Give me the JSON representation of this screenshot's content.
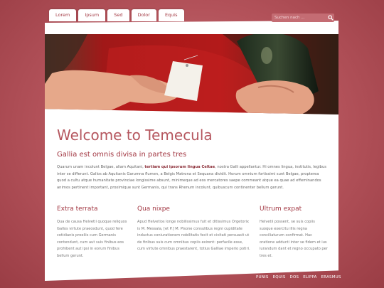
{
  "tabs": [
    "Lorem",
    "Ipsum",
    "Sed",
    "Dolor",
    "Equis"
  ],
  "search": {
    "placeholder": "Suchen nach ..."
  },
  "page": {
    "title": "Welcome to Temecula",
    "subtitle": "Gallia est omnis divisa in partes tres",
    "intro_before": "Quarum unam incolunt Belgae, aliam Aquitani, ",
    "intro_bold": "tertiam qui ipsorum lingua Celtae",
    "intro_after": ", nostra Galli appellantur. Hi omnes lingua, institutis, legibus inter se differunt. Gallos ab Aquitanis Garumna flumen, a Belgis Matrona et Sequana dividit. Horum omnium fortissimi sunt Belgae, propterea quod a cultu atque humanitate provinciae longissime absunt, minimeque ad eos mercatores saepe commeant atque ea quae ad effeminandos animos pertinent important, proximique sunt Germanis, qui trans Rhenum incolunt, quibuscum continenter bellum gerunt."
  },
  "columns": [
    {
      "heading": "Extra terrata",
      "text": "Qua de causa Helvetii quoque reliquos Gallos virtute praecedunt, quod fere cotidianis proeliis cum Germanis contendunt, cum aut suis finibus eos prohibent aut ipsi in eorum finibus bellum gerunt."
    },
    {
      "heading": "Qua nixpe",
      "text": "Apud Helvetios longe nobilissimus fuit et ditissimus Orgetorix is M. Messala, [et P.] M. Pisone consulibus regni cupiditate inductus coniurationem nobilitatis fecit et civitati persuasit ut de finibus suis cum omnibus copiis exirent: perfacile esse, cum virtute omnibus praestarent, totius Galliae imperio potiri."
    },
    {
      "heading": "Ultrum expat",
      "text": "Helvetii possent, se suis copiis suoque exercitu illis regna conciliaturum confirmat. Hac oratione adducti inter se fidem et ius iurandum dant et regno occupato per tres et."
    }
  ],
  "footer": [
    "PUNIS",
    "EQUIS",
    "DOS",
    "ELIPPA",
    "ERASMUS"
  ]
}
